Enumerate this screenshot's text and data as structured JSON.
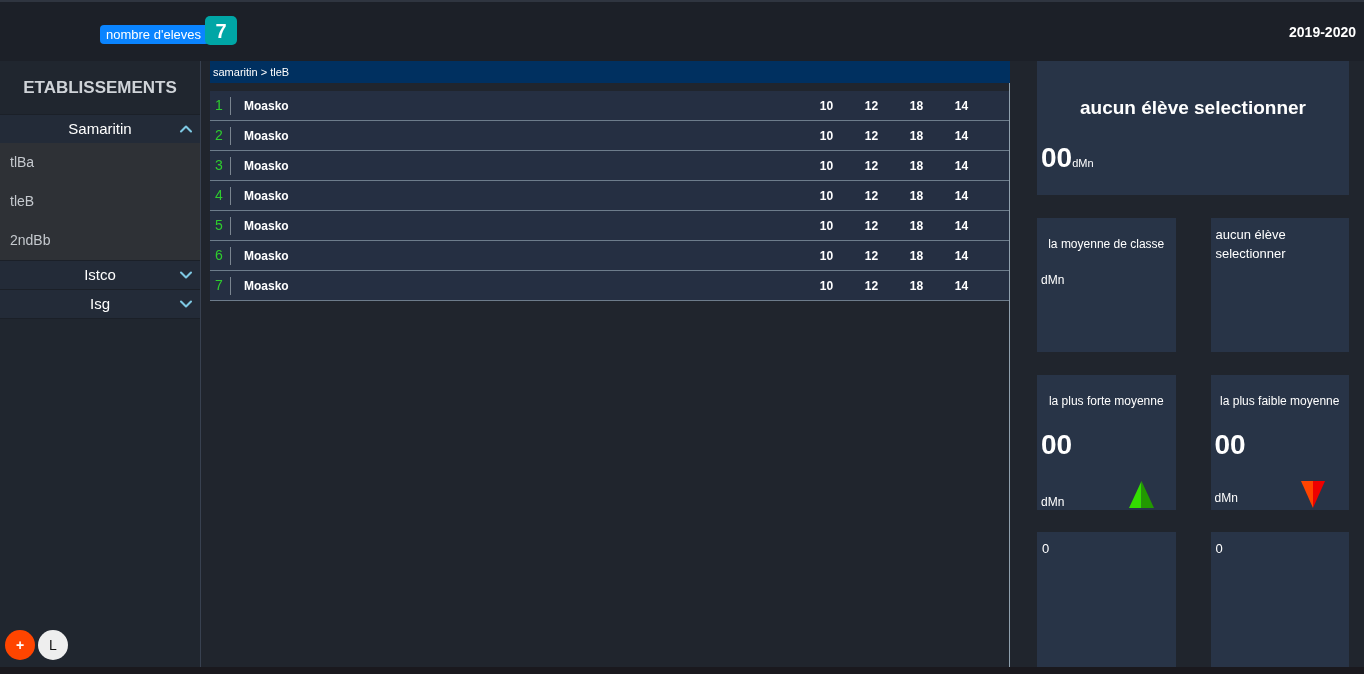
{
  "header": {
    "count_label": "nombre d'eleves",
    "count": "7",
    "year": "2019-2020"
  },
  "sidebar": {
    "title": "ETABLISSEMENTS",
    "schools": [
      {
        "name": "Samaritin",
        "expanded": true,
        "classes": [
          "tlBa",
          "tleB",
          "2ndBb"
        ]
      },
      {
        "name": "Istco",
        "expanded": false
      },
      {
        "name": "Isg",
        "expanded": false
      }
    ],
    "buttons": [
      {
        "kind": "add",
        "label": "+"
      },
      {
        "kind": "user",
        "label": "L"
      }
    ]
  },
  "breadcrumb": "samaritin > tleB",
  "students": [
    {
      "rank": "1",
      "name": "Moasko",
      "grades": [
        "10",
        "12",
        "18",
        "14"
      ]
    },
    {
      "rank": "2",
      "name": "Moasko",
      "grades": [
        "10",
        "12",
        "18",
        "14"
      ]
    },
    {
      "rank": "3",
      "name": "Moasko",
      "grades": [
        "10",
        "12",
        "18",
        "14"
      ]
    },
    {
      "rank": "4",
      "name": "Moasko",
      "grades": [
        "10",
        "12",
        "18",
        "14"
      ]
    },
    {
      "rank": "5",
      "name": "Moasko",
      "grades": [
        "10",
        "12",
        "18",
        "14"
      ]
    },
    {
      "rank": "6",
      "name": "Moasko",
      "grades": [
        "10",
        "12",
        "18",
        "14"
      ]
    },
    {
      "rank": "7",
      "name": "Moasko",
      "grades": [
        "10",
        "12",
        "18",
        "14"
      ]
    }
  ],
  "summary": {
    "title": "aucun élève selectionner",
    "value": "00",
    "unit": "dMn"
  },
  "class_average": {
    "title": "la moyenne de classe",
    "unit": "dMn"
  },
  "student_note": "aucun élève selectionner",
  "highest_average": {
    "title": "la plus forte moyenne",
    "value": "00",
    "unit": "dMn"
  },
  "lowest_average": {
    "title": "la plus faible moyenne",
    "value": "00",
    "unit": "dMn"
  },
  "counts": [
    "0",
    "0"
  ]
}
